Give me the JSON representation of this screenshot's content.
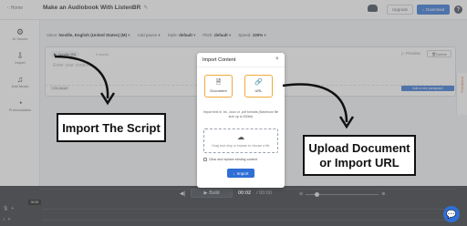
{
  "header": {
    "home_label": "Home",
    "doc_title": "Make an Audiobook With ListenBR",
    "upgrade_label": "Upgrade",
    "download_label": "Download",
    "help_label": "?"
  },
  "sidebar": {
    "items": [
      {
        "label": "AI Voices",
        "icon": "sparkle-icon"
      },
      {
        "label": "Import",
        "icon": "import-icon"
      },
      {
        "label": "Add Music",
        "icon": "music-icon"
      },
      {
        "label": "Pronunciation",
        "icon": "pronunciation-icon"
      }
    ]
  },
  "toolbar": {
    "voice_label": "Voice:",
    "voice_value": "Noville, English (United States) (M)",
    "add_pause": "Add pause",
    "style_label": "Style:",
    "style_value": "default",
    "pitch_label": "Pitch:",
    "pitch_value": "default",
    "speed_label": "Speed:",
    "speed_value": "100%"
  },
  "editor": {
    "voice_chip": "Noville (M)",
    "words": "0 words",
    "placeholder": "Enter your content...",
    "preview_label": "Preview",
    "delete_label": "Delete",
    "pause_tag": "0.5s pause",
    "add_paragraph_label": "Add a new paragraph"
  },
  "feedback": {
    "label": "Feedback"
  },
  "modal": {
    "title": "Import Content",
    "close": "×",
    "option_document": "Document",
    "option_url": "URL",
    "hint": "Import text in .txt, .docx or .pdf formats (Maximum file size up to 500kb)",
    "drop_text": "Drag and drop or browse to choose a file",
    "replace_label": "Clear and replace existing content",
    "import_label": "Import"
  },
  "player": {
    "build_label": "Build",
    "time_current": "00:02",
    "time_total": "/ 00:00",
    "time_badge": "00:00"
  },
  "callouts": {
    "script": "Import The Script",
    "upload_line1": "Upload Document",
    "upload_line2": "or Import URL"
  },
  "colors": {
    "accent": "#2f6fd6",
    "option_border": "#f0a93b",
    "player_bg": "#2b2e33"
  }
}
